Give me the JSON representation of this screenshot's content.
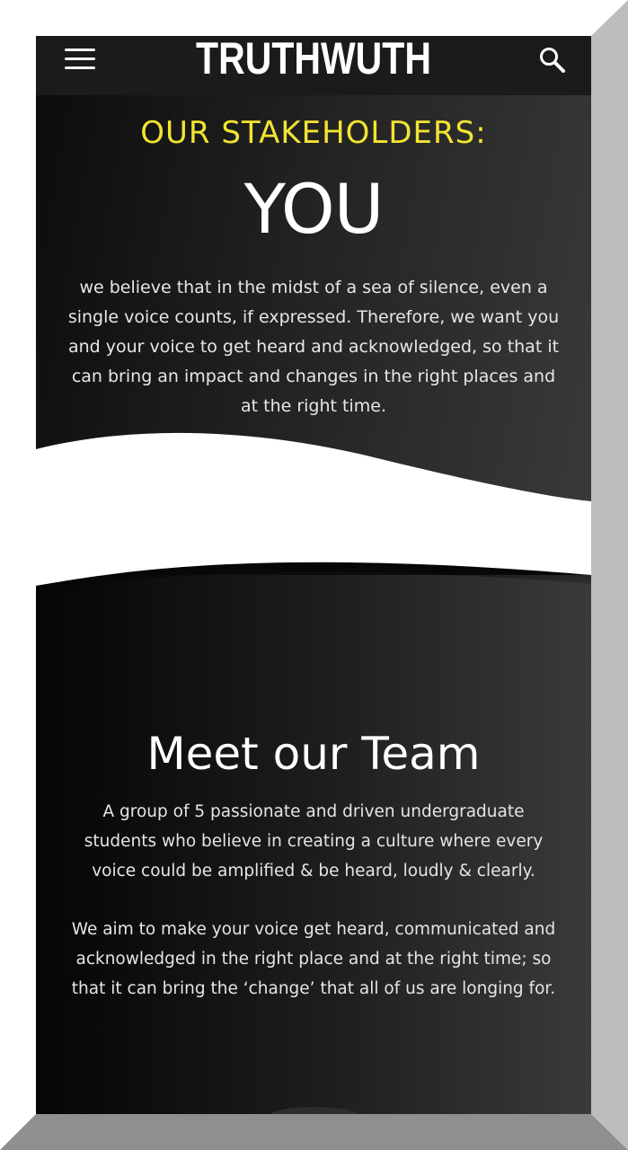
{
  "header": {
    "brand": "TRUTHWUTH",
    "menu_icon": "hamburger-menu-icon",
    "search_icon": "search-icon"
  },
  "stakeholders": {
    "title": "OUR STAKEHOLDERS:",
    "subject": "YOU",
    "body_lines": [
      "we believe that in the midst of a sea of silence, even a",
      "single voice counts, if expressed. Therefore, we want you",
      "and your voice to get heard and acknowledged, so that it",
      "can bring an impact and changes in the right places and",
      "at the right time."
    ]
  },
  "team": {
    "title": "Meet our Team",
    "paragraph1_lines": [
      "A group of 5 passionate and driven undergraduate",
      "students who believe in  creating a culture where every",
      "voice could be amplified & be heard, loudly & clearly."
    ],
    "paragraph2_lines": [
      "We aim to make your voice get heard, communicated and",
      "acknowledged in the right place and at the right time; so",
      "that it can bring the ‘change’ that all of us are longing for."
    ]
  },
  "colors": {
    "accent_yellow": "#f2e432",
    "header_bg": "#1b1b1b",
    "text_light": "#e7e7e7"
  }
}
